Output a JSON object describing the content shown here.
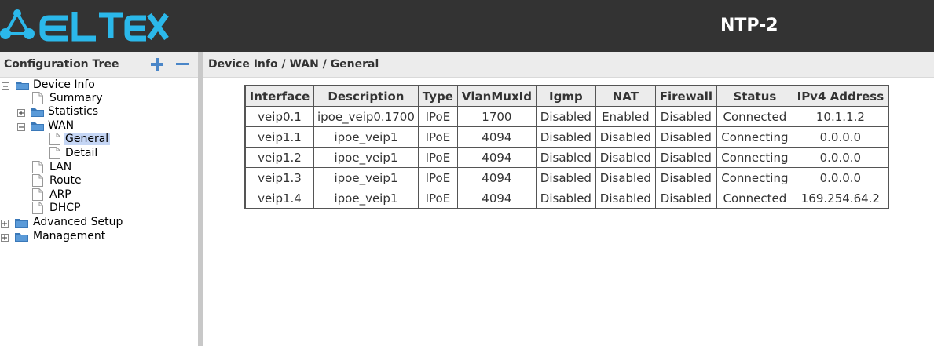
{
  "header": {
    "logo_text": "ELTEX",
    "device_name": "NTP-2",
    "colors": {
      "bar": "#333333",
      "logo": "#2bb8ea"
    }
  },
  "sidebar": {
    "title": "Configuration Tree",
    "expand_all_icon": "plus-icon",
    "collapse_all_icon": "minus-icon",
    "tree": [
      {
        "label": "Device Info",
        "type": "folder",
        "expanded": true,
        "depth": 0
      },
      {
        "label": "Summary",
        "type": "page",
        "depth": 1
      },
      {
        "label": "Statistics",
        "type": "folder",
        "expanded": false,
        "depth": 1
      },
      {
        "label": "WAN",
        "type": "folder",
        "expanded": true,
        "depth": 1
      },
      {
        "label": "General",
        "type": "page",
        "depth": 2,
        "selected": true
      },
      {
        "label": "Detail",
        "type": "page",
        "depth": 2
      },
      {
        "label": "LAN",
        "type": "page",
        "depth": 1
      },
      {
        "label": "Route",
        "type": "page",
        "depth": 1
      },
      {
        "label": "ARP",
        "type": "page",
        "depth": 1
      },
      {
        "label": "DHCP",
        "type": "page",
        "depth": 1
      },
      {
        "label": "Advanced Setup",
        "type": "folder",
        "expanded": false,
        "depth": 0
      },
      {
        "label": "Management",
        "type": "folder",
        "expanded": false,
        "depth": 0
      }
    ]
  },
  "main": {
    "breadcrumb": "Device Info / WAN / General",
    "table": {
      "columns": [
        "Interface",
        "Description",
        "Type",
        "VlanMuxId",
        "Igmp",
        "NAT",
        "Firewall",
        "Status",
        "IPv4 Address"
      ],
      "rows": [
        [
          "veip0.1",
          "ipoe_veip0.1700",
          "IPoE",
          "1700",
          "Disabled",
          "Enabled",
          "Disabled",
          "Connected",
          "10.1.1.2"
        ],
        [
          "veip1.1",
          "ipoe_veip1",
          "IPoE",
          "4094",
          "Disabled",
          "Disabled",
          "Disabled",
          "Connecting",
          "0.0.0.0"
        ],
        [
          "veip1.2",
          "ipoe_veip1",
          "IPoE",
          "4094",
          "Disabled",
          "Disabled",
          "Disabled",
          "Connecting",
          "0.0.0.0"
        ],
        [
          "veip1.3",
          "ipoe_veip1",
          "IPoE",
          "4094",
          "Disabled",
          "Disabled",
          "Disabled",
          "Connecting",
          "0.0.0.0"
        ],
        [
          "veip1.4",
          "ipoe_veip1",
          "IPoE",
          "4094",
          "Disabled",
          "Disabled",
          "Disabled",
          "Connected",
          "169.254.64.2"
        ]
      ],
      "status_colors": {
        "Connected": "#1a8a1a",
        "Connecting": "#f0a000"
      }
    }
  }
}
